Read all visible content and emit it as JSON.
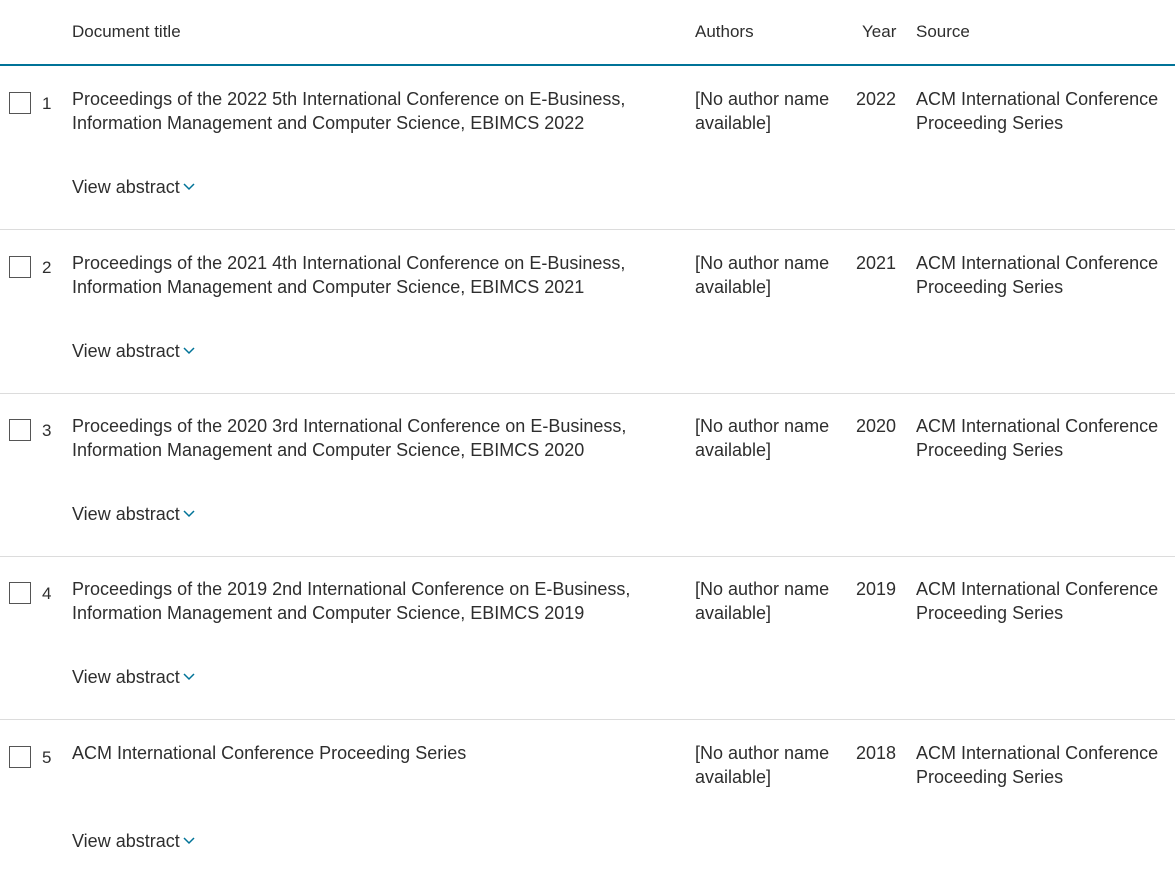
{
  "table": {
    "headers": {
      "title": "Document title",
      "authors": "Authors",
      "year": "Year",
      "source": "Source"
    },
    "rows": [
      {
        "num": "1",
        "title": "Proceedings of the 2022 5th International Conference on E-Business, Information Management and Computer Science, EBIMCS 2022",
        "authors": "[No author name available]",
        "year": "2022",
        "source": "ACM International Conference Proceeding Series",
        "abstract_label": "View abstract"
      },
      {
        "num": "2",
        "title": "Proceedings of the 2021 4th International Conference on E-Business, Information Management and Computer Science, EBIMCS 2021",
        "authors": "[No author name available]",
        "year": "2021",
        "source": "ACM International Conference Proceeding Series",
        "abstract_label": "View abstract"
      },
      {
        "num": "3",
        "title": "Proceedings of the 2020 3rd International Conference on E-Business, Information Management and Computer Science, EBIMCS 2020",
        "authors": "[No author name available]",
        "year": "2020",
        "source": "ACM International Conference Proceeding Series",
        "abstract_label": "View abstract"
      },
      {
        "num": "4",
        "title": "Proceedings of the 2019 2nd International Conference on E-Business, Information Management and Computer Science, EBIMCS 2019",
        "authors": "[No author name available]",
        "year": "2019",
        "source": "ACM International Conference Proceeding Series",
        "abstract_label": "View abstract"
      },
      {
        "num": "5",
        "title": "ACM International Conference Proceeding Series",
        "authors": "[No author name available]",
        "year": "2018",
        "source": "ACM International Conference Proceeding Series",
        "abstract_label": "View abstract"
      }
    ]
  },
  "icons": {
    "checkbox": "checkbox-icon",
    "chevron": "chevron-down-icon"
  },
  "colors": {
    "header_rule": "#007398",
    "chevron": "#007398",
    "text": "#2e2e2e",
    "row_divider": "#dcdcdc"
  }
}
